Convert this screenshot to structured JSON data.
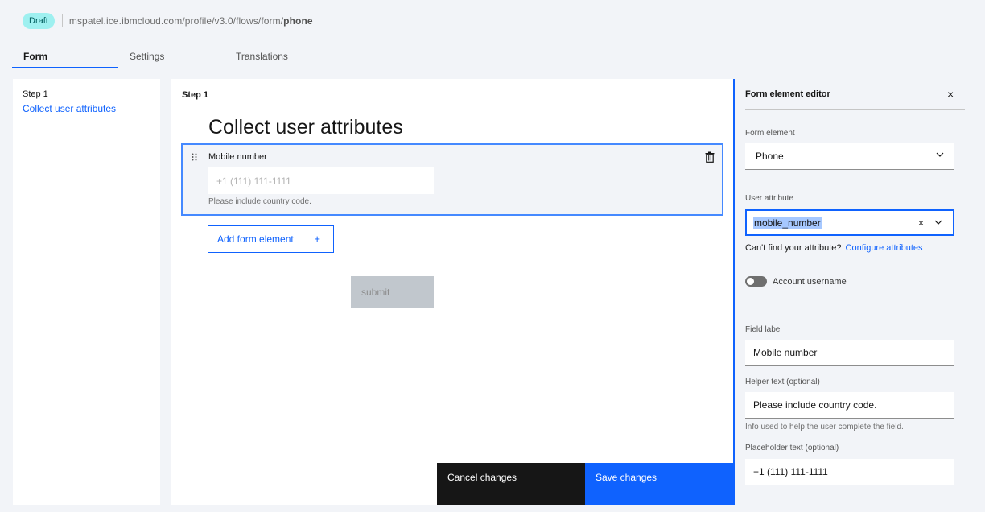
{
  "header": {
    "status_badge": "Draft",
    "url_prefix": "mspatel.ice.ibmcloud.com/profile/v3.0/flows/form/",
    "url_last": "phone"
  },
  "tabs": [
    {
      "label": "Form",
      "active": true
    },
    {
      "label": "Settings",
      "active": false
    },
    {
      "label": "Translations",
      "active": false
    }
  ],
  "step_nav": {
    "step_title": "Step 1",
    "step_link": "Collect user attributes"
  },
  "canvas": {
    "step_label": "Step 1",
    "heading": "Collect user attributes",
    "form_element": {
      "drag_icon": "drag-handle-icon",
      "label": "Mobile number",
      "placeholder": "+1 (111) 111-1111",
      "helper": "Please include country code.",
      "delete_icon": "trash-icon"
    },
    "add_element_label": "Add form element",
    "add_icon": "+",
    "submit_label": "submit"
  },
  "action_bar": {
    "cancel_label": "Cancel changes",
    "save_label": "Save changes"
  },
  "editor": {
    "title": "Form element editor",
    "close_icon": "×",
    "form_element_label": "Form element",
    "form_element_value": "Phone",
    "user_attribute_label": "User attribute",
    "user_attribute_value": "mobile_number",
    "clear_icon": "×",
    "cant_find_text": "Can't find your attribute?",
    "configure_link": "Configure attributes",
    "account_username_label": "Account username",
    "account_username_on": false,
    "field_label_label": "Field label",
    "field_label_value": "Mobile number",
    "helper_text_label": "Helper text (optional)",
    "helper_text_value": "Please include country code.",
    "helper_text_hint": "Info used to help the user complete the field.",
    "placeholder_label": "Placeholder text (optional)",
    "placeholder_value": "+1 (111) 111-1111"
  },
  "colors": {
    "accent": "#0f62fe",
    "badge_bg": "#9ef0f0",
    "page_bg": "#f2f4f8",
    "dark_button": "#161616",
    "disabled_button": "#c1c7cd"
  }
}
